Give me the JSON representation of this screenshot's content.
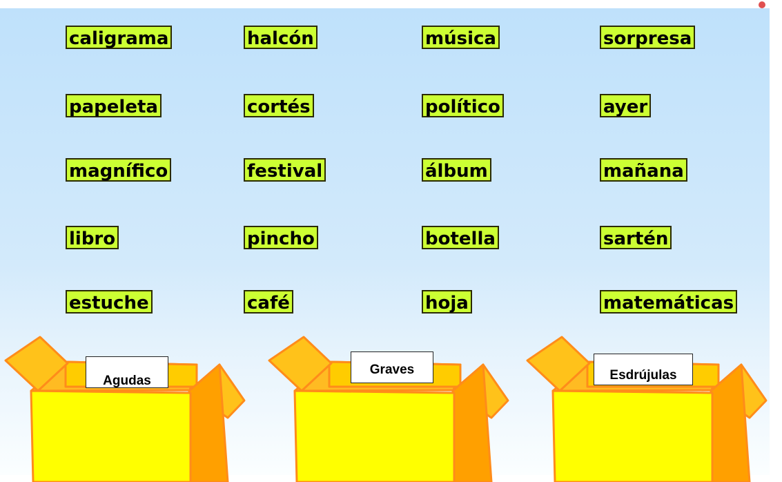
{
  "words": [
    "caligrama",
    "halcón",
    "música",
    "sorpresa",
    "papeleta",
    "cortés",
    "político",
    "ayer",
    "magnífico",
    "festival",
    "álbum",
    "mañana",
    "libro",
    "pincho",
    "botella",
    "sartén",
    "estuche",
    "café",
    "hoja",
    "matemáticas"
  ],
  "boxes": [
    {
      "label": "Agudas"
    },
    {
      "label": "Graves"
    },
    {
      "label": "Esdrújulas"
    }
  ],
  "colors": {
    "word_tile": "#ccff33",
    "box_front": "#ffff00",
    "box_side": "#ffa500",
    "box_outline": "#ff8c1a",
    "sky_top": "#bfe1fb"
  }
}
